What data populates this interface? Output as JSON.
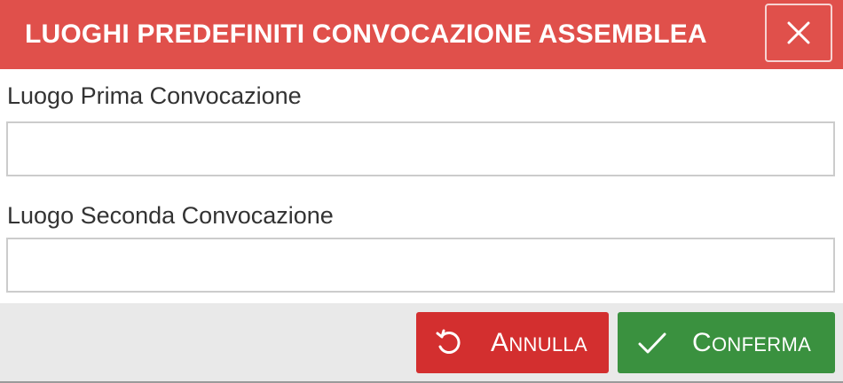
{
  "dialog": {
    "title": "LUOGHI PREDEFINITI CONVOCAZIONE ASSEMBLEA",
    "close_icon": "close-icon"
  },
  "fields": {
    "first": {
      "label": "Luogo Prima Convocazione",
      "value": "",
      "placeholder": ""
    },
    "second": {
      "label": "Luogo Seconda Convocazione",
      "value": "",
      "placeholder": ""
    }
  },
  "footer": {
    "cancel_label": "Annulla",
    "cancel_icon": "undo-icon",
    "confirm_label": "Conferma",
    "confirm_icon": "check-icon"
  },
  "colors": {
    "header": "#e0504b",
    "cancel": "#d32f2f",
    "confirm": "#3a913f",
    "footer_bg": "#e9e9e9"
  }
}
